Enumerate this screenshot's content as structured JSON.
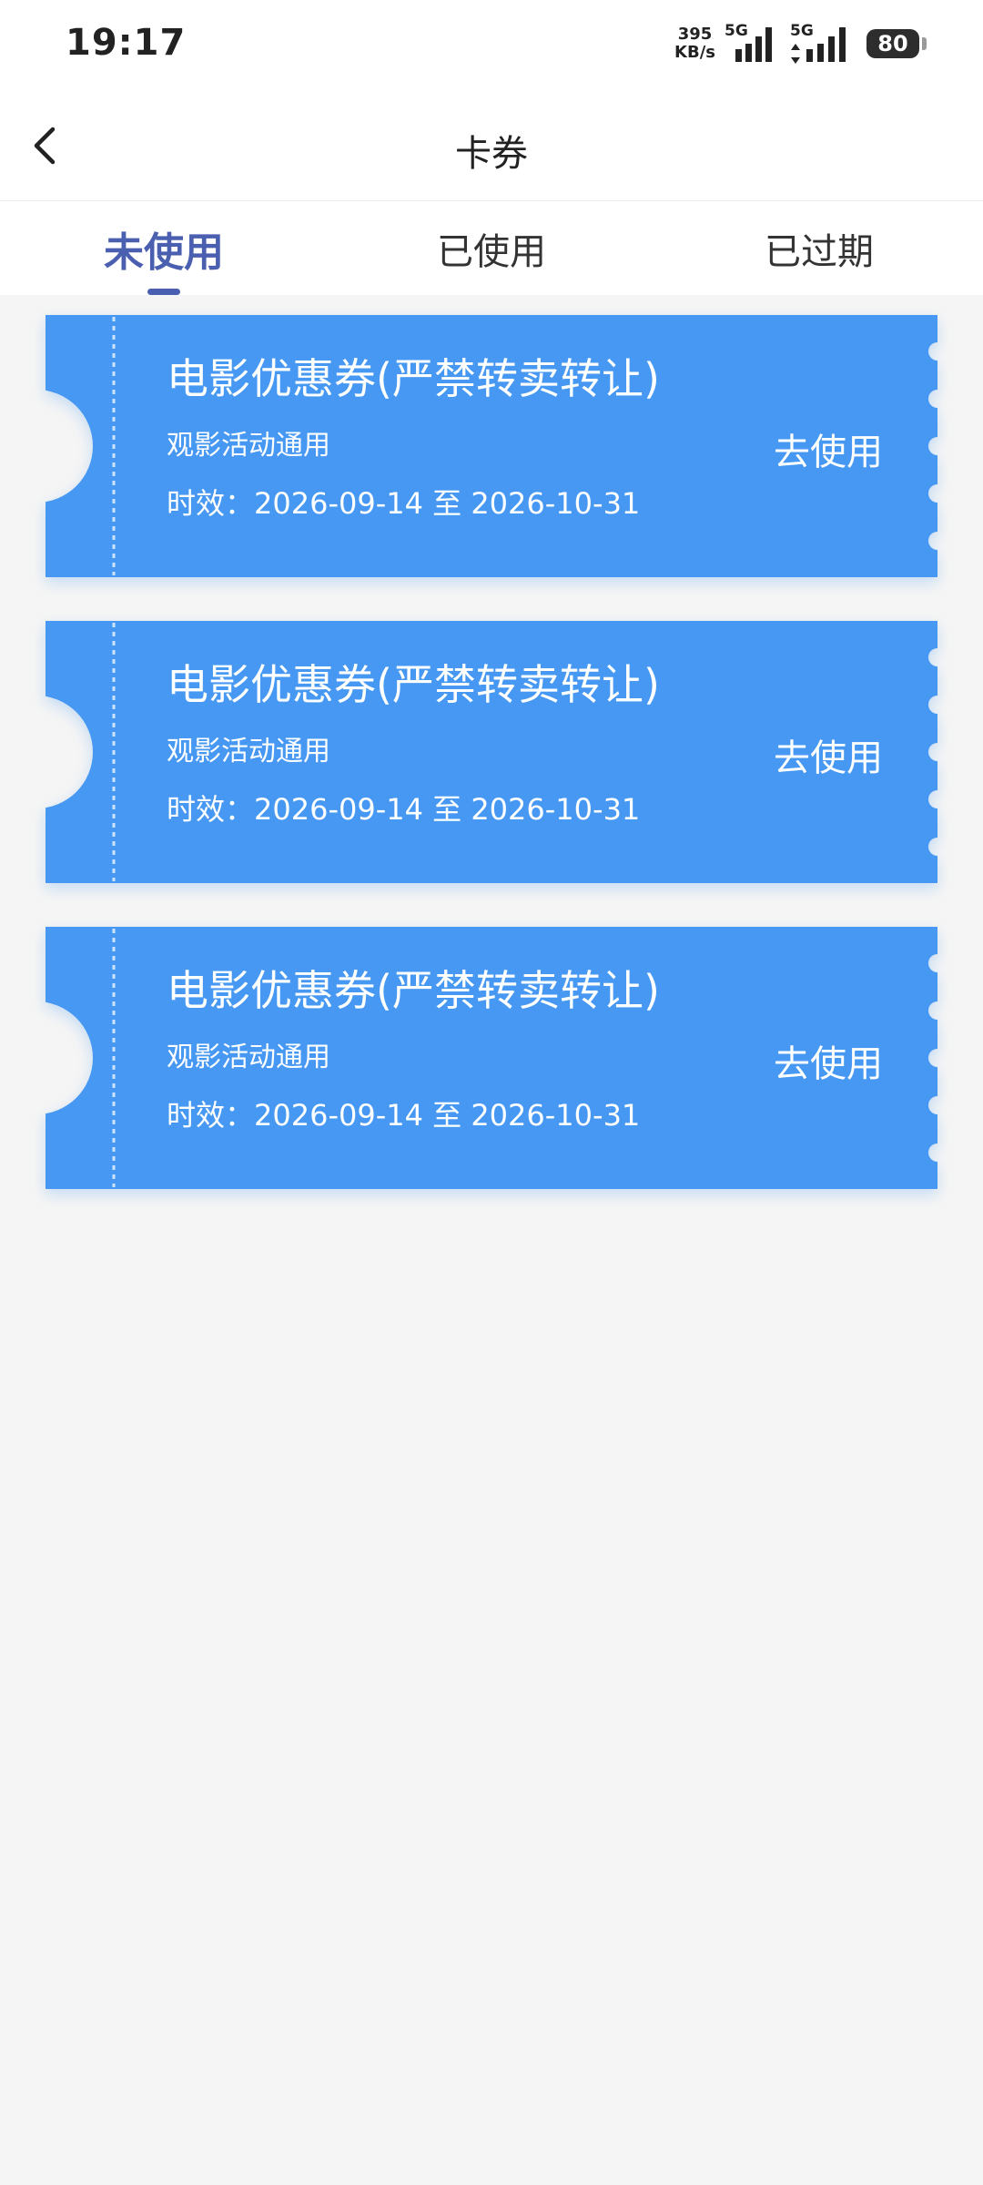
{
  "status_bar": {
    "time": "19:17",
    "speed_value": "395",
    "speed_unit": "KB/s",
    "net_type_1": "5G",
    "net_type_2": "5G",
    "battery": "80"
  },
  "header": {
    "title": "卡券",
    "back_icon": "chevron-left-icon"
  },
  "tabs": [
    {
      "label": "未使用",
      "active": true
    },
    {
      "label": "已使用",
      "active": false
    },
    {
      "label": "已过期",
      "active": false
    }
  ],
  "coupons": [
    {
      "title": "电影优惠券(严禁转卖转让)",
      "description": "观影活动通用",
      "validity": "时效：2026-09-14 至 2026-10-31",
      "action_label": "去使用"
    },
    {
      "title": "电影优惠券(严禁转卖转让)",
      "description": "观影活动通用",
      "validity": "时效：2026-09-14 至 2026-10-31",
      "action_label": "去使用"
    },
    {
      "title": "电影优惠券(严禁转卖转让)",
      "description": "观影活动通用",
      "validity": "时效：2026-09-14 至 2026-10-31",
      "action_label": "去使用"
    }
  ],
  "colors": {
    "coupon_blue": "#4698f2",
    "tab_active": "#4a5fb0",
    "page_background": "#f5f5f5"
  }
}
